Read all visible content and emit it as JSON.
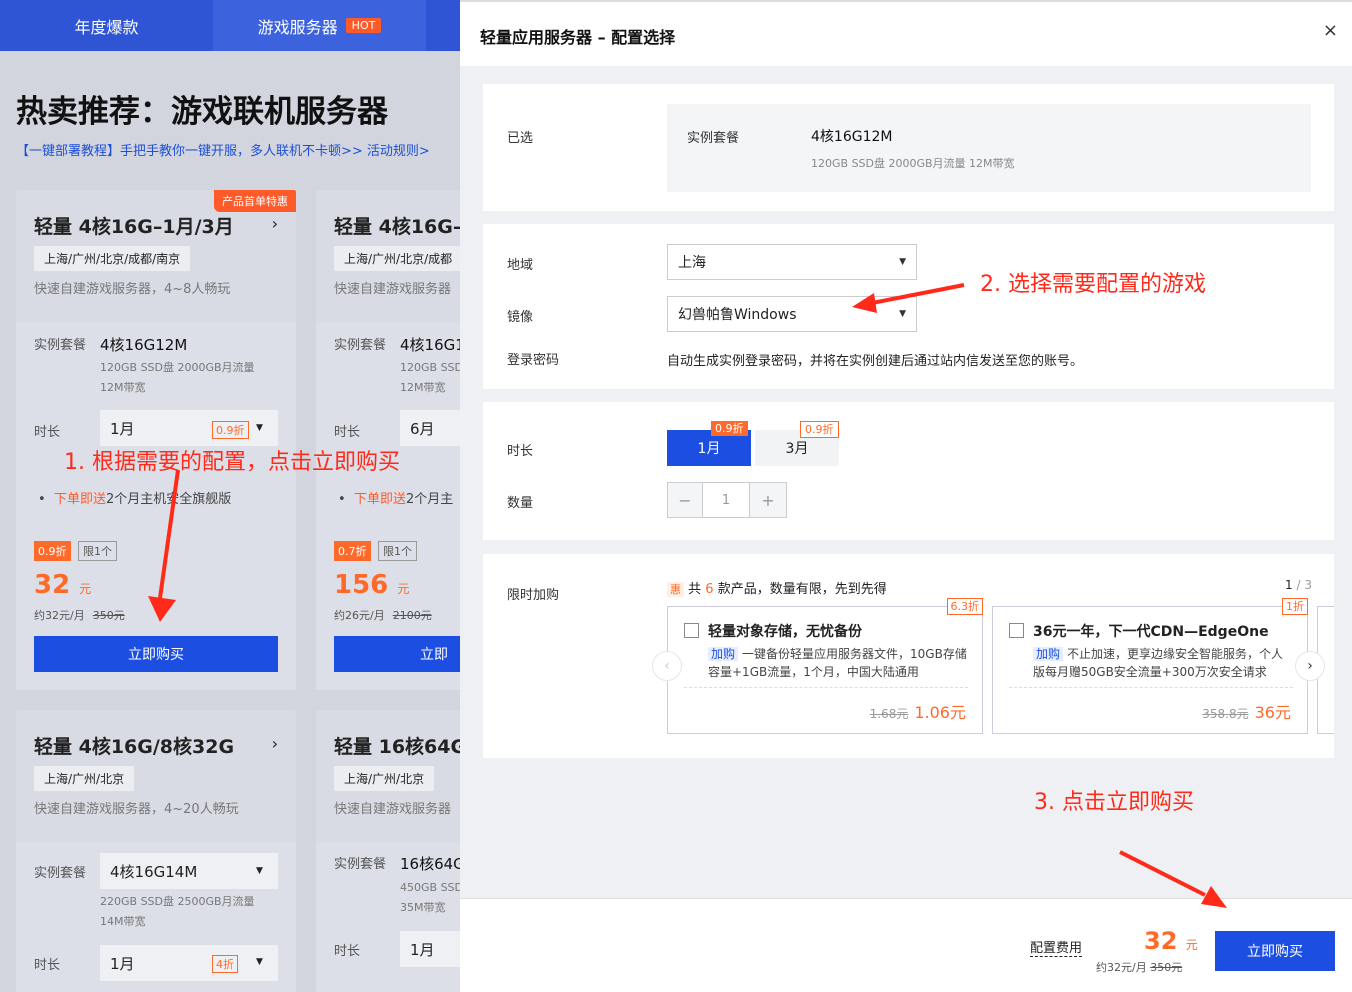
{
  "bg": {
    "tabs": [
      "年度爆款",
      "游戏服务器"
    ],
    "hot_badge": "HOT",
    "title": "热卖推荐：游戏联机服务器",
    "links": "【一键部署教程】手把手教你一键开服，多人联机不卡顿>>    活动规则>",
    "cards": [
      {
        "title": "轻量 4核16G–1月/3月",
        "promo": "产品首单特惠",
        "regions": "上海/广州/北京/成都/南京",
        "desc": "快速自建游戏服务器，4~8人畅玩",
        "spec_label": "实例套餐",
        "spec": "4核16G12M",
        "spec_sub1": "120GB SSD盘 2000GB月流量",
        "spec_sub2": "12M带宽",
        "dur_label": "时长",
        "dur": "1月",
        "dur_disc": "0.9折",
        "gift_red": "下单即送",
        "gift": "2个月主机安全旗舰版",
        "disc": "0.9折",
        "limit": "限1个",
        "price": "32",
        "unit": "元",
        "permo": "约32元/月",
        "orig": "350元",
        "buy": "立即购买"
      },
      {
        "title": "轻量 4核16G–",
        "regions": "上海/广州/北京/成都",
        "desc": "快速自建游戏服务器",
        "spec_label": "实例套餐",
        "spec": "4核16G1",
        "spec_sub1": "120GB SSD",
        "spec_sub2": "12M带宽",
        "dur_label": "时长",
        "dur": "6月",
        "gift_red": "下单即送",
        "gift": "2个月主",
        "disc": "0.7折",
        "limit": "限1个",
        "price": "156",
        "unit": "元",
        "permo": "约26元/月",
        "orig": "2100元",
        "buy": "立即"
      },
      {
        "title": "轻量 4核16G/8核32G",
        "regions": "上海/广州/北京",
        "desc": "快速自建游戏服务器，4~20人畅玩",
        "spec_label": "实例套餐",
        "spec": "4核16G14M",
        "spec_sub1": "220GB SSD盘 2500GB月流量",
        "spec_sub2": "14M带宽",
        "dur_label": "时长",
        "dur": "1月",
        "dur_disc": "4折"
      },
      {
        "title": "轻量 16核64G",
        "regions": "上海/广州/北京",
        "desc": "快速自建游戏服务器",
        "spec_label": "实例套餐",
        "spec": "16核64G",
        "spec_sub1": "450GB SSD",
        "spec_sub2": "35M带宽",
        "dur_label": "时长",
        "dur": "1月"
      }
    ]
  },
  "annotations": {
    "a1": "1. 根据需要的配置，点击立即购买",
    "a2": "2. 选择需要配置的游戏",
    "a3": "3. 点击立即购买"
  },
  "panel": {
    "title": "轻量应用服务器 – 配置选择",
    "close": "×",
    "selected": {
      "label": "已选",
      "key": "实例套餐",
      "value": "4核16G12M",
      "detail": "120GB SSD盘 2000GB月流量 12M带宽"
    },
    "region": {
      "label": "地域",
      "value": "上海"
    },
    "image": {
      "label": "镜像",
      "value": "幻兽帕鲁Windows"
    },
    "password": {
      "label": "登录密码",
      "text": "自动生成实例登录密码，并将在实例创建后通过站内信发送至您的账号。"
    },
    "duration": {
      "label": "时长",
      "options": [
        {
          "label": "1月",
          "tag": "0.9折"
        },
        {
          "label": "3月",
          "tag": "0.9折"
        }
      ]
    },
    "quantity": {
      "label": "数量",
      "value": "1",
      "minus": "−",
      "plus": "+"
    },
    "addon": {
      "label": "限时加购",
      "hui": "惠",
      "text_pre": "共",
      "count": "6",
      "text_post": "款产品，数量有限，先到先得",
      "page": "1",
      "page_sep": " / ",
      "page_total": "3",
      "items": [
        {
          "title": "轻量对象存储，无忧备份",
          "tag": "加购",
          "desc": "一键备份轻量应用服务器文件，10GB存储容量+1GB流量，1个月，中国大陆通用",
          "orig": "1.68元",
          "price": "1.06元",
          "disc": "6.3折"
        },
        {
          "title": "36元一年，下一代CDN—EdgeOne",
          "tag": "加购",
          "desc": "不止加速，更享边缘安全智能服务，个人版每月赠50GB安全流量+300万次安全请求",
          "orig": "358.8元",
          "price": "36元",
          "disc": "1折"
        }
      ]
    },
    "footer": {
      "fee_label": "配置费用",
      "price": "32",
      "unit": "元",
      "permo": "约32元/月",
      "orig": "350元",
      "buy": "立即购买"
    }
  },
  "colors": {
    "brand": "#1c4fe1",
    "accent": "#ff6a2a",
    "annotation": "#ff2a1a"
  }
}
